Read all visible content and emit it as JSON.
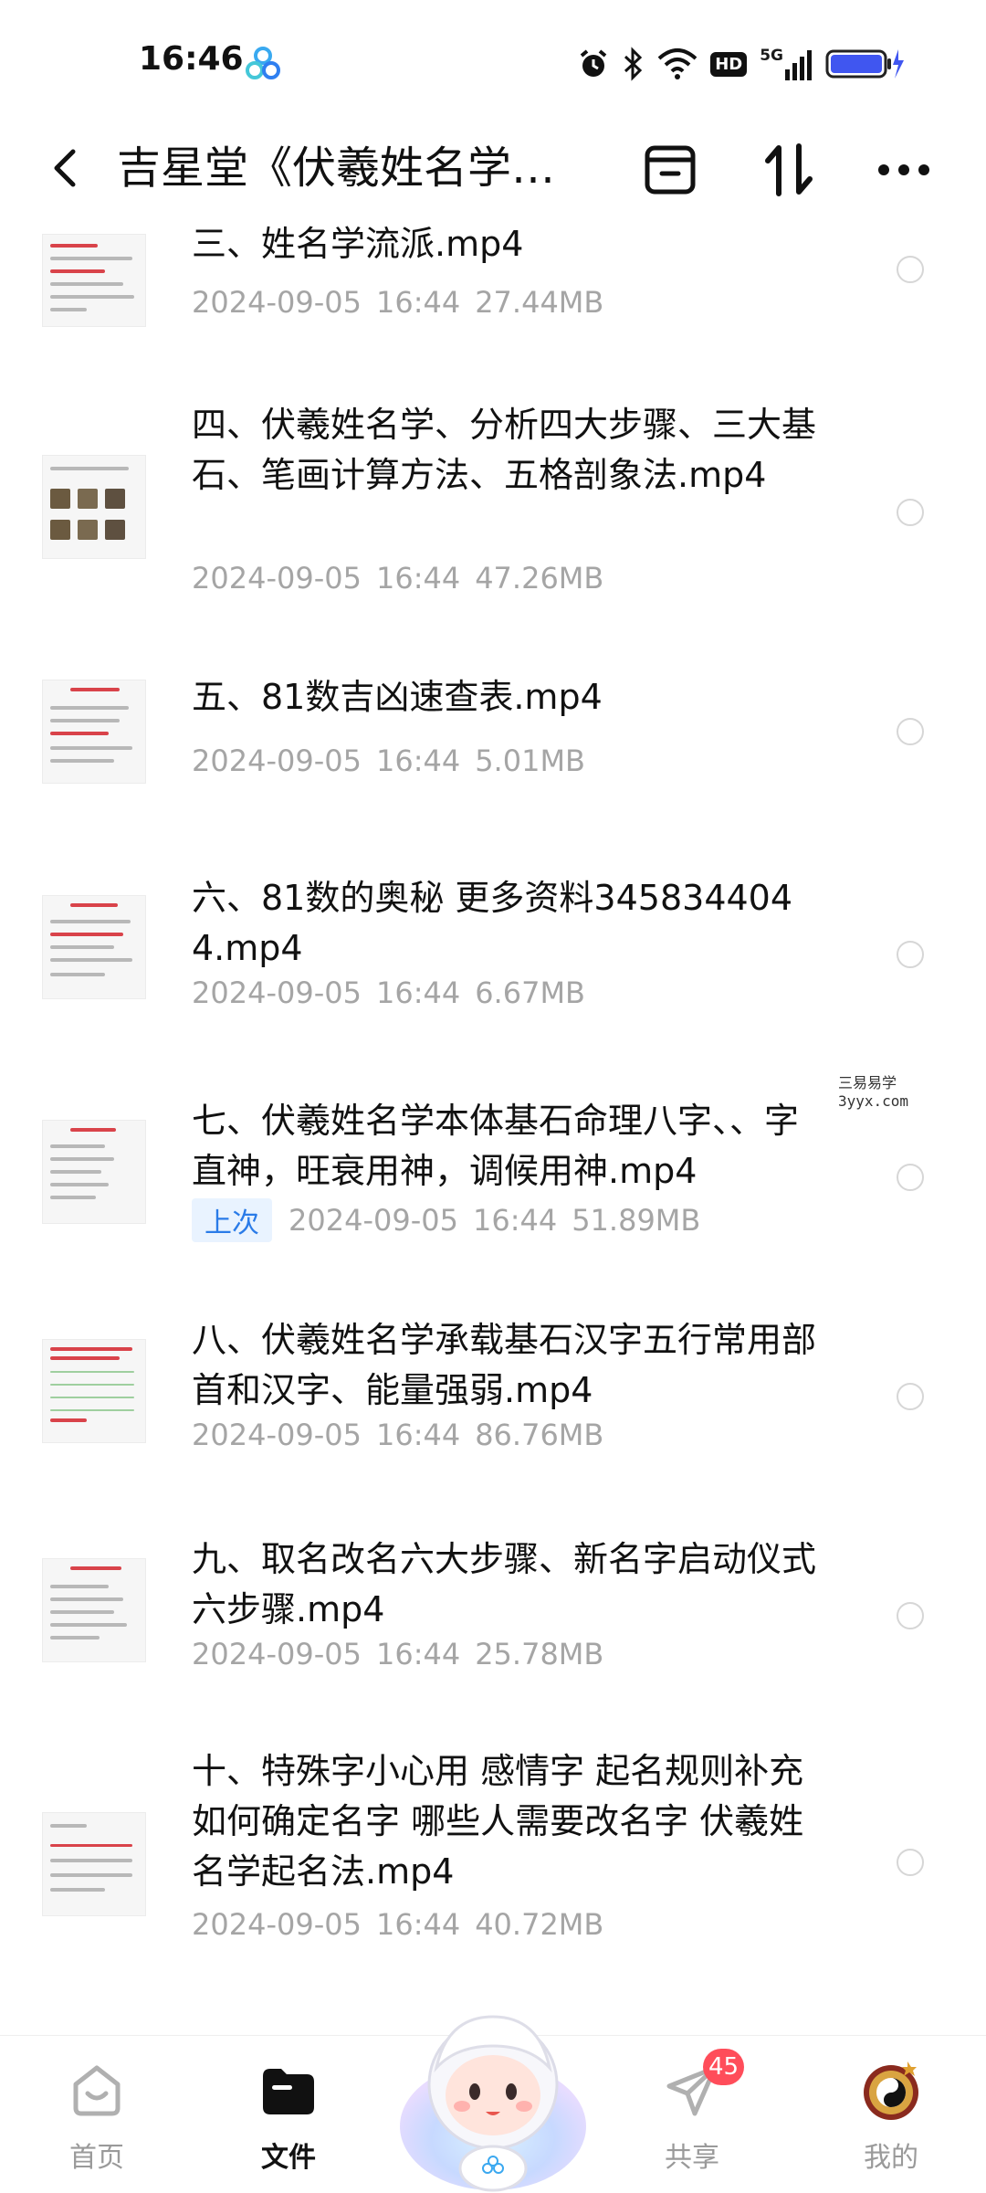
{
  "status_bar": {
    "time": "16:46",
    "hd": "HD",
    "network": "5G"
  },
  "header": {
    "title": "吉星堂《伏羲姓名学…"
  },
  "files": [
    {
      "name": "三、姓名学流派.mp4",
      "date": "2024-09-05",
      "time": "16:44",
      "size": "27.44MB"
    },
    {
      "name": "四、伏羲姓名学、分析四大步骤、三大基石、笔画计算方法、五格剖象法.mp4",
      "date": "2024-09-05",
      "time": "16:44",
      "size": "47.26MB"
    },
    {
      "name": "五、81数吉凶速查表.mp4",
      "date": "2024-09-05",
      "time": "16:44",
      "size": "5.01MB"
    },
    {
      "name": "六、81数的奥秘 更多资料3458344044.mp4",
      "date": "2024-09-05",
      "time": "16:44",
      "size": "6.67MB"
    },
    {
      "name": "七、伏羲姓名学本体基石命理八字、、字直神，旺衰用神，调候用神.mp4",
      "date": "2024-09-05",
      "time": "16:44",
      "size": "51.89MB",
      "tag": "上次"
    },
    {
      "name": "八、伏羲姓名学承载基石汉字五行常用部首和汉字、能量强弱.mp4",
      "date": "2024-09-05",
      "time": "16:44",
      "size": "86.76MB"
    },
    {
      "name": "九、取名改名六大步骤、新名字启动仪式六步骤.mp4",
      "date": "2024-09-05",
      "time": "16:44",
      "size": "25.78MB"
    },
    {
      "name": "十、特殊字小心用 感情字 起名规则补充 如何确定名字 哪些人需要改名字 伏羲姓名学起名法.mp4",
      "date": "2024-09-05",
      "time": "16:44",
      "size": "40.72MB"
    }
  ],
  "watermark": {
    "line1": "三易易学",
    "line2": "3yyx.com"
  },
  "bottom_nav": {
    "home": "首页",
    "files": "文件",
    "share": "共享",
    "share_badge": "45",
    "mine": "我的"
  }
}
